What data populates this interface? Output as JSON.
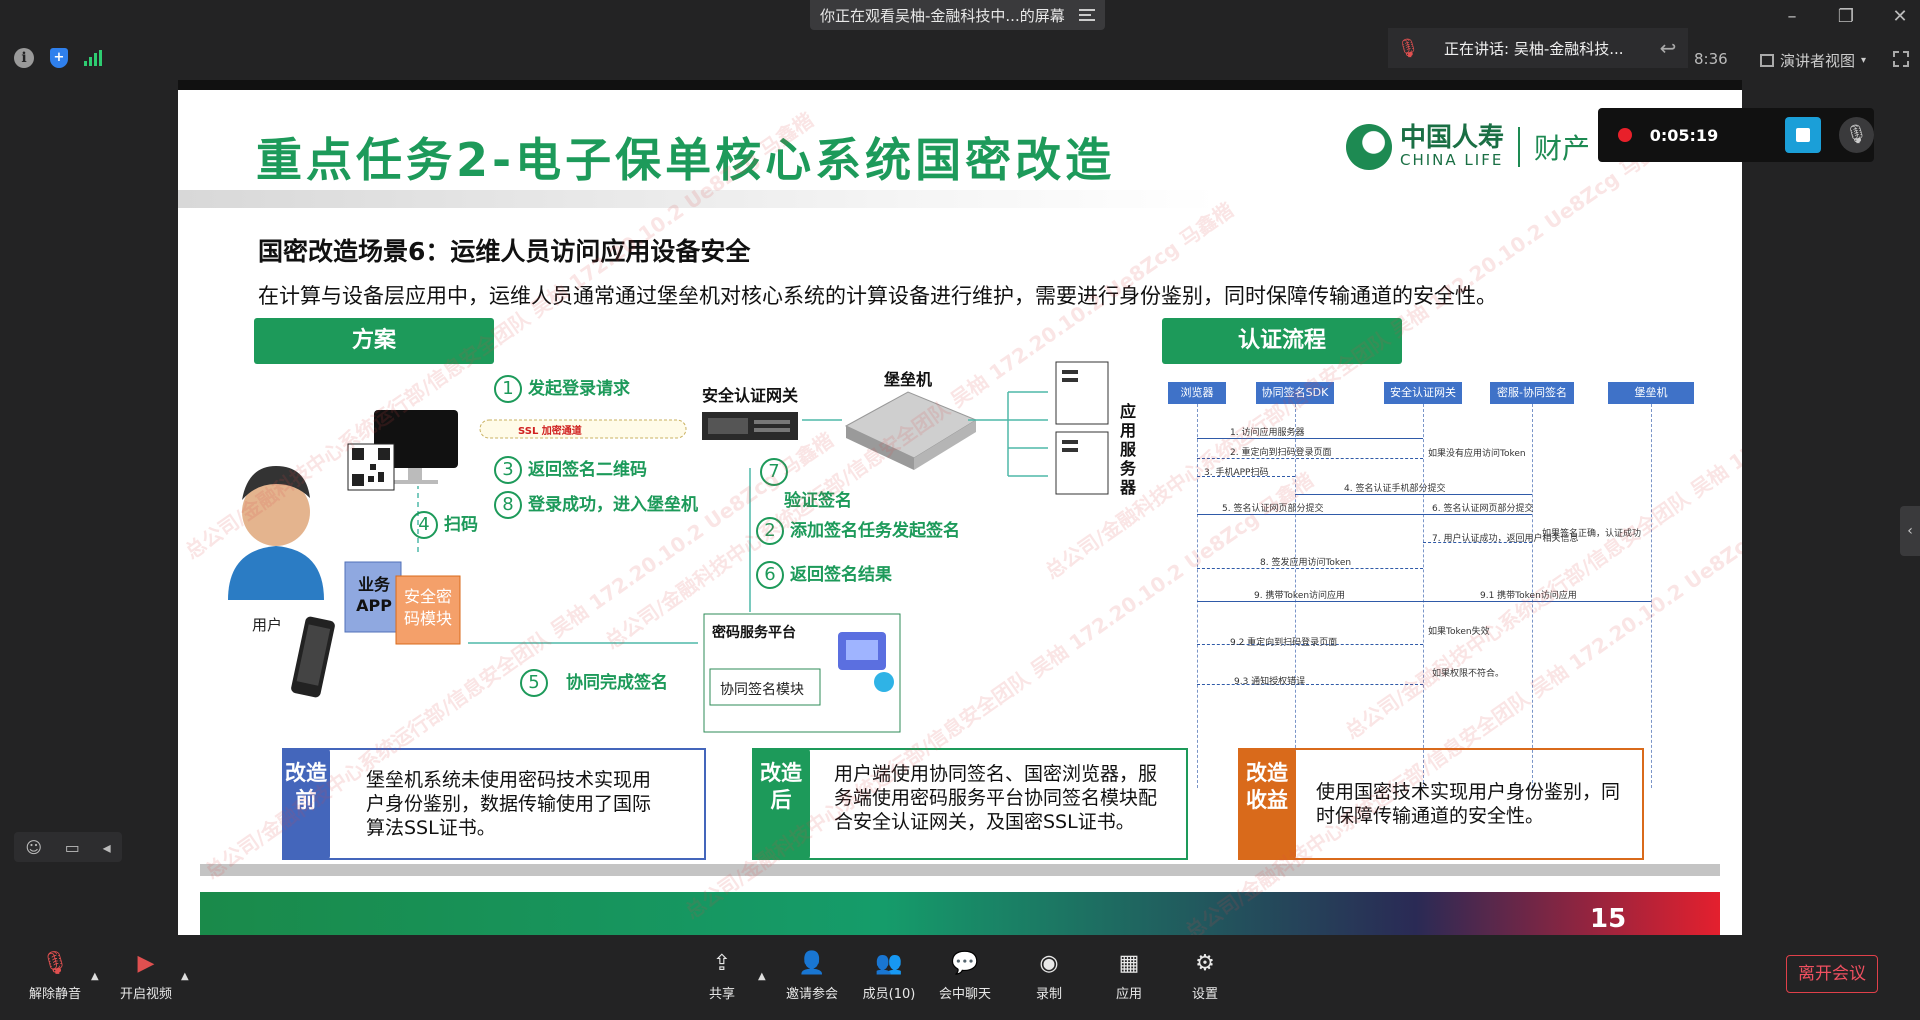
{
  "window": {
    "share_banner": "你正在观看吴柚-金融科技中...的屏幕",
    "speaker_text": "正在讲话: 吴柚-金融科技...",
    "clock": "8:36",
    "view_mode": "演讲者视图",
    "recording_time": "0:05:19"
  },
  "slide": {
    "title": "重点任务2-电子保单核心系统国密改造",
    "logo_cn": "中国人寿",
    "logo_en": "CHINA LIFE",
    "logo_fin": "财产",
    "scene_title": "国密改造场景6：运维人员访问应用设备安全",
    "scene_desc": "在计算与设备层应用中，运维人员通常通过堡垒机对核心系统的计算设备进行维护，需要进行身份鉴别，同时保障传输通道的安全性。",
    "tab_solution": "方案",
    "tab_flow": "认证流程",
    "diagram": {
      "step1": "发起登录请求",
      "step3": "返回签名二维码",
      "step8": "登录成功，进入堡垒机",
      "step4": "扫码",
      "step7": "验证签名",
      "step2": "添加签名任务发起签名",
      "step6": "返回签名结果",
      "step5": "协同完成签名",
      "ssl": "SSL 加密通道",
      "gateway": "安全认证网关",
      "bastion": "堡垒机",
      "app_server": "应用服务器",
      "user": "用户",
      "biz_app": "业务APP",
      "crypto_module": "安全密码模块",
      "crypto_platform": "密码服务平台",
      "cosign_module": "协同签名模块",
      "n1": "1",
      "n2": "2",
      "n3": "3",
      "n4": "4",
      "n5": "5",
      "n6": "6",
      "n7": "7",
      "n8": "8"
    },
    "flow": {
      "headers": [
        "浏览器",
        "协同签名SDK",
        "安全认证网关",
        "密服-协同签名",
        "堡垒机"
      ],
      "steps": [
        "1. 访问应用服务器",
        "2. 重定向到扫码登录页面",
        "如果没有应用访问Token",
        "3. 手机APP扫码",
        "4. 签名认证手机部分提交",
        "5. 签名认证网页部分提交",
        "6. 签名认证网页部分提交",
        "如果签名正确，认证成功",
        "7. 用户认证成功，返回用户相关信息",
        "8. 签发应用访问Token",
        "9. 携带Token访问应用",
        "9.1 携带Token访问应用",
        "如果Token失效",
        "9.2 重定向到扫码登录页面",
        "如果权限不符合。",
        "9.3 通知授权错误"
      ]
    },
    "before": {
      "tag": "改造前",
      "text": "堡垒机系统未使用密码技术实现用户身份鉴别，数据传输使用了国际算法SSL证书。"
    },
    "after": {
      "tag": "改造后",
      "text": "用户端使用协同签名、国密浏览器，服务端使用密码服务平台协同签名模块配合安全认证网关，及国密SSL证书。"
    },
    "benefit": {
      "tag": "改造收益",
      "text": "使用国密技术实现用户身份鉴别，同时保障传输通道的安全性。"
    },
    "page_number": "15",
    "watermark": "总公司/金融科技中心系统运行部/信息安全团队 吴柚 172.20.10.2 Ue8Zcg 马鑫楷"
  },
  "toolbar": {
    "unmute": "解除静音",
    "video": "开启视频",
    "share": "共享",
    "invite": "邀请参会",
    "members": "成员(10)",
    "chat": "会中聊天",
    "record": "录制",
    "apps": "应用",
    "settings": "设置",
    "leave": "离开会议"
  },
  "colors": {
    "accent_green": "#1d9a5a",
    "before_blue": "#4466bb",
    "benefit_orange": "#d96a1b",
    "leave_red": "#e0404a"
  }
}
